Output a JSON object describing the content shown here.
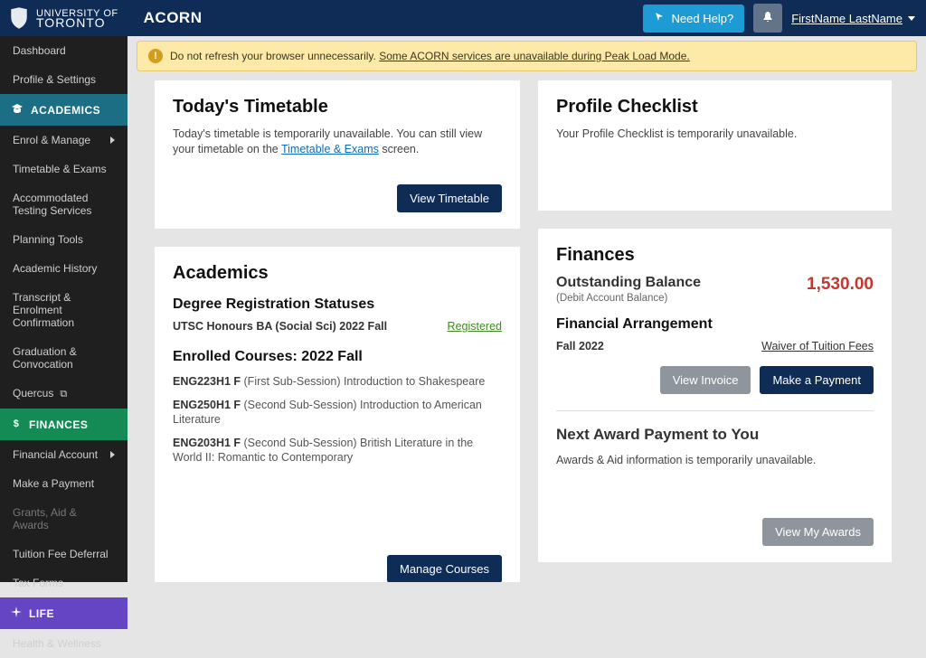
{
  "header": {
    "university_top": "UNIVERSITY OF",
    "university_bottom": "TORONTO",
    "app_name": "ACORN",
    "need_help": "Need Help?",
    "user_name": "FirstName LastName"
  },
  "warning": {
    "prefix": "Do not refresh your browser unnecessarily. ",
    "link_text": "Some ACORN services are unavailable during Peak Load Mode."
  },
  "sidebar": {
    "top": [
      {
        "label": "Dashboard"
      },
      {
        "label": "Profile & Settings"
      }
    ],
    "academics_header": "ACADEMICS",
    "academics": [
      {
        "label": "Enrol & Manage",
        "chevron": true
      },
      {
        "label": "Timetable & Exams"
      },
      {
        "label": "Accommodated Testing Services"
      },
      {
        "label": "Planning Tools"
      },
      {
        "label": "Academic History"
      },
      {
        "label": "Transcript & Enrolment Confirmation"
      },
      {
        "label": "Graduation & Convocation"
      },
      {
        "label": "Quercus",
        "external": true
      }
    ],
    "finances_header": "FINANCES",
    "finances": [
      {
        "label": "Financial Account",
        "chevron": true
      },
      {
        "label": "Make a Payment"
      },
      {
        "label": "Grants, Aid & Awards",
        "disabled": true
      },
      {
        "label": "Tuition Fee Deferral"
      },
      {
        "label": "Tax Forms"
      }
    ],
    "life_header": "LIFE",
    "life": [
      {
        "label": "Health & Wellness"
      }
    ]
  },
  "timetable_card": {
    "title": "Today's Timetable",
    "body_prefix": "Today's timetable is temporarily unavailable. You can still view your timetable on the ",
    "link": "Timetable & Exams",
    "body_suffix": " screen.",
    "button": "View Timetable"
  },
  "profile_card": {
    "title": "Profile Checklist",
    "body": "Your Profile Checklist is temporarily unavailable."
  },
  "academics_card": {
    "title": "Academics",
    "degree_title": "Degree Registration Statuses",
    "program": "UTSC Honours BA (Social Sci) 2022 Fall",
    "status": "Registered",
    "enrolled_title": "Enrolled Courses: 2022 Fall",
    "courses": [
      {
        "code": "ENG223H1 F",
        "desc": "(First Sub-Session) Introduction to Shakespeare"
      },
      {
        "code": "ENG250H1 F",
        "desc": "(Second Sub-Session) Introduction to American Literature"
      },
      {
        "code": "ENG203H1 F",
        "desc": "(Second Sub-Session) British Literature in the World II: Romantic to Contemporary"
      }
    ],
    "button": "Manage Courses"
  },
  "finances_card": {
    "title": "Finances",
    "balance_label": "Outstanding Balance",
    "balance_sub": "(Debit Account Balance)",
    "balance_amount": "1,530.00",
    "fa_title": "Financial Arrangement",
    "fa_term": "Fall 2022",
    "fa_value": "Waiver of Tuition Fees",
    "invoice_btn": "View Invoice",
    "payment_btn": "Make a Payment",
    "award_title": "Next Award Payment to You",
    "award_body": "Awards & Aid information is temporarily unavailable.",
    "award_btn": "View My Awards"
  }
}
